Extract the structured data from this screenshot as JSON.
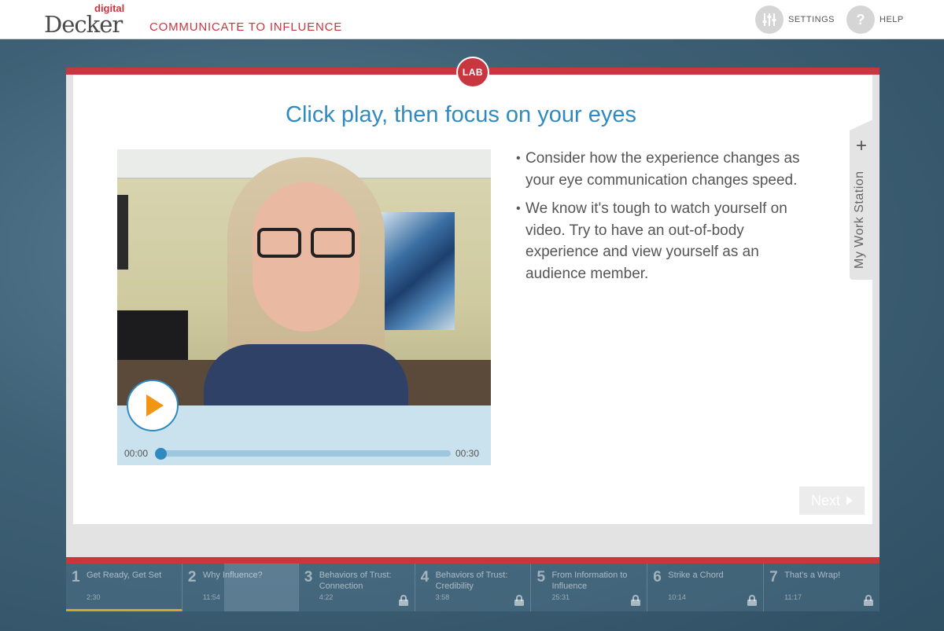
{
  "header": {
    "logo_sub": "digital",
    "logo_brand": "Decker",
    "course_title": "COMMUNICATE TO INFLUENCE",
    "settings_label": "SETTINGS",
    "help_label": "HELP",
    "help_glyph": "?"
  },
  "lab": {
    "badge": "LAB",
    "title": "Click play, then focus on your eyes",
    "bullets": [
      "Consider how the experience changes as your eye communication changes speed.",
      "We know it's tough to watch yourself on video. Try to have an out-of-body experience and view yourself as an audience member."
    ],
    "next_label": "Next"
  },
  "video": {
    "current_time": "00:00",
    "duration": "00:30",
    "progress": 0
  },
  "workstation": {
    "label": "My Work Station",
    "plus": "+"
  },
  "chapters": [
    {
      "num": "1",
      "title": "Get Ready, Get Set",
      "duration": "2:30",
      "locked": false
    },
    {
      "num": "2",
      "title": "Why Influence?",
      "duration": "11:54",
      "locked": false
    },
    {
      "num": "3",
      "title": "Behaviors of Trust: Connection",
      "duration": "4:22",
      "locked": true
    },
    {
      "num": "4",
      "title": "Behaviors of Trust: Credibility",
      "duration": "3:58",
      "locked": true
    },
    {
      "num": "5",
      "title": "From Information to Influence",
      "duration": "25:31",
      "locked": true
    },
    {
      "num": "6",
      "title": "Strike a Chord",
      "duration": "10:14",
      "locked": true
    },
    {
      "num": "7",
      "title": "That's a Wrap!",
      "duration": "11:17",
      "locked": true
    }
  ],
  "colors": {
    "brand_red": "#c8373f",
    "title_blue": "#2f8abf",
    "play_orange": "#f29512"
  },
  "icons": {
    "settings": "sliders-icon",
    "help": "question-icon",
    "play": "play-icon",
    "next": "triangle-right-icon",
    "lock": "lock-icon",
    "plus": "plus-icon"
  }
}
